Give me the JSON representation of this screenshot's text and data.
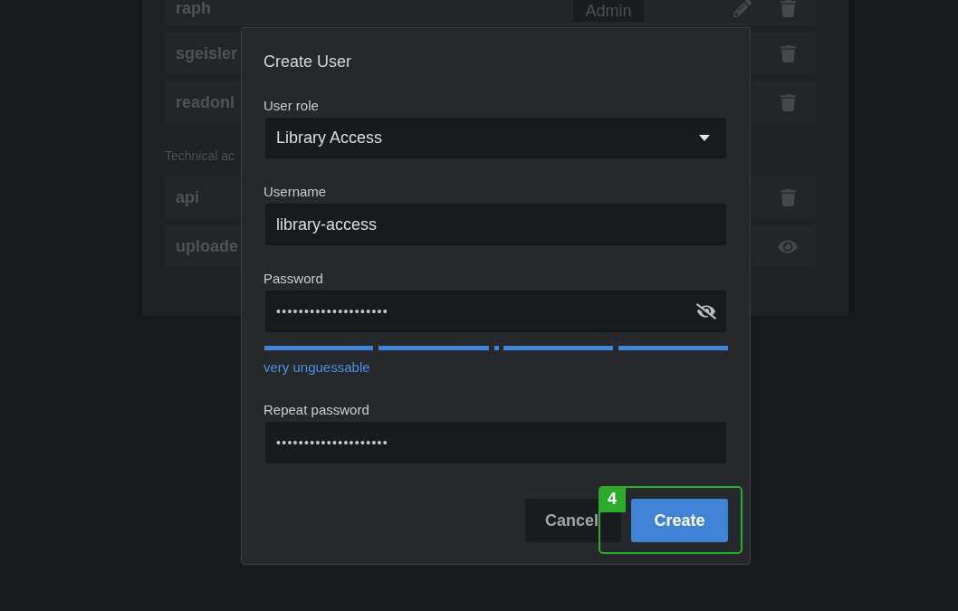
{
  "background_panel": {
    "user_rows": [
      {
        "name": "raph",
        "badge": "Admin",
        "actions": [
          {
            "kind": "edit"
          },
          {
            "kind": "delete"
          }
        ]
      },
      {
        "name": "sgeisler",
        "actions": [
          {
            "kind": "delete"
          }
        ]
      },
      {
        "name": "readonl",
        "actions": [
          {
            "kind": "delete"
          }
        ]
      }
    ],
    "section_label": "Technical ac",
    "technical_rows": [
      {
        "name": "api",
        "actions": [
          {
            "kind": "delete"
          }
        ]
      },
      {
        "name": "uploade",
        "actions": [
          {
            "kind": "view"
          }
        ]
      }
    ]
  },
  "dialog": {
    "title": "Create User",
    "fields": [
      {
        "kind": "select",
        "label": "User role",
        "value": "Library Access"
      },
      {
        "kind": "text",
        "label": "Username",
        "value": "library-access"
      },
      {
        "kind": "password",
        "label": "Password",
        "value": "••••••••••••••••••••",
        "revealed": false,
        "strength": {
          "segments": [
            {
              "filled": true
            },
            {
              "filled": true
            },
            {
              "filled": true
            },
            {
              "filled": true
            },
            {
              "filled": true
            }
          ],
          "label": "very unguessable"
        }
      },
      {
        "kind": "password",
        "label": "Repeat password",
        "value": "••••••••••••••••••••"
      }
    ],
    "buttons": [
      {
        "kind": "secondary",
        "label": "Cancel"
      },
      {
        "kind": "primary",
        "label": "Create",
        "callout": "4"
      }
    ]
  }
}
